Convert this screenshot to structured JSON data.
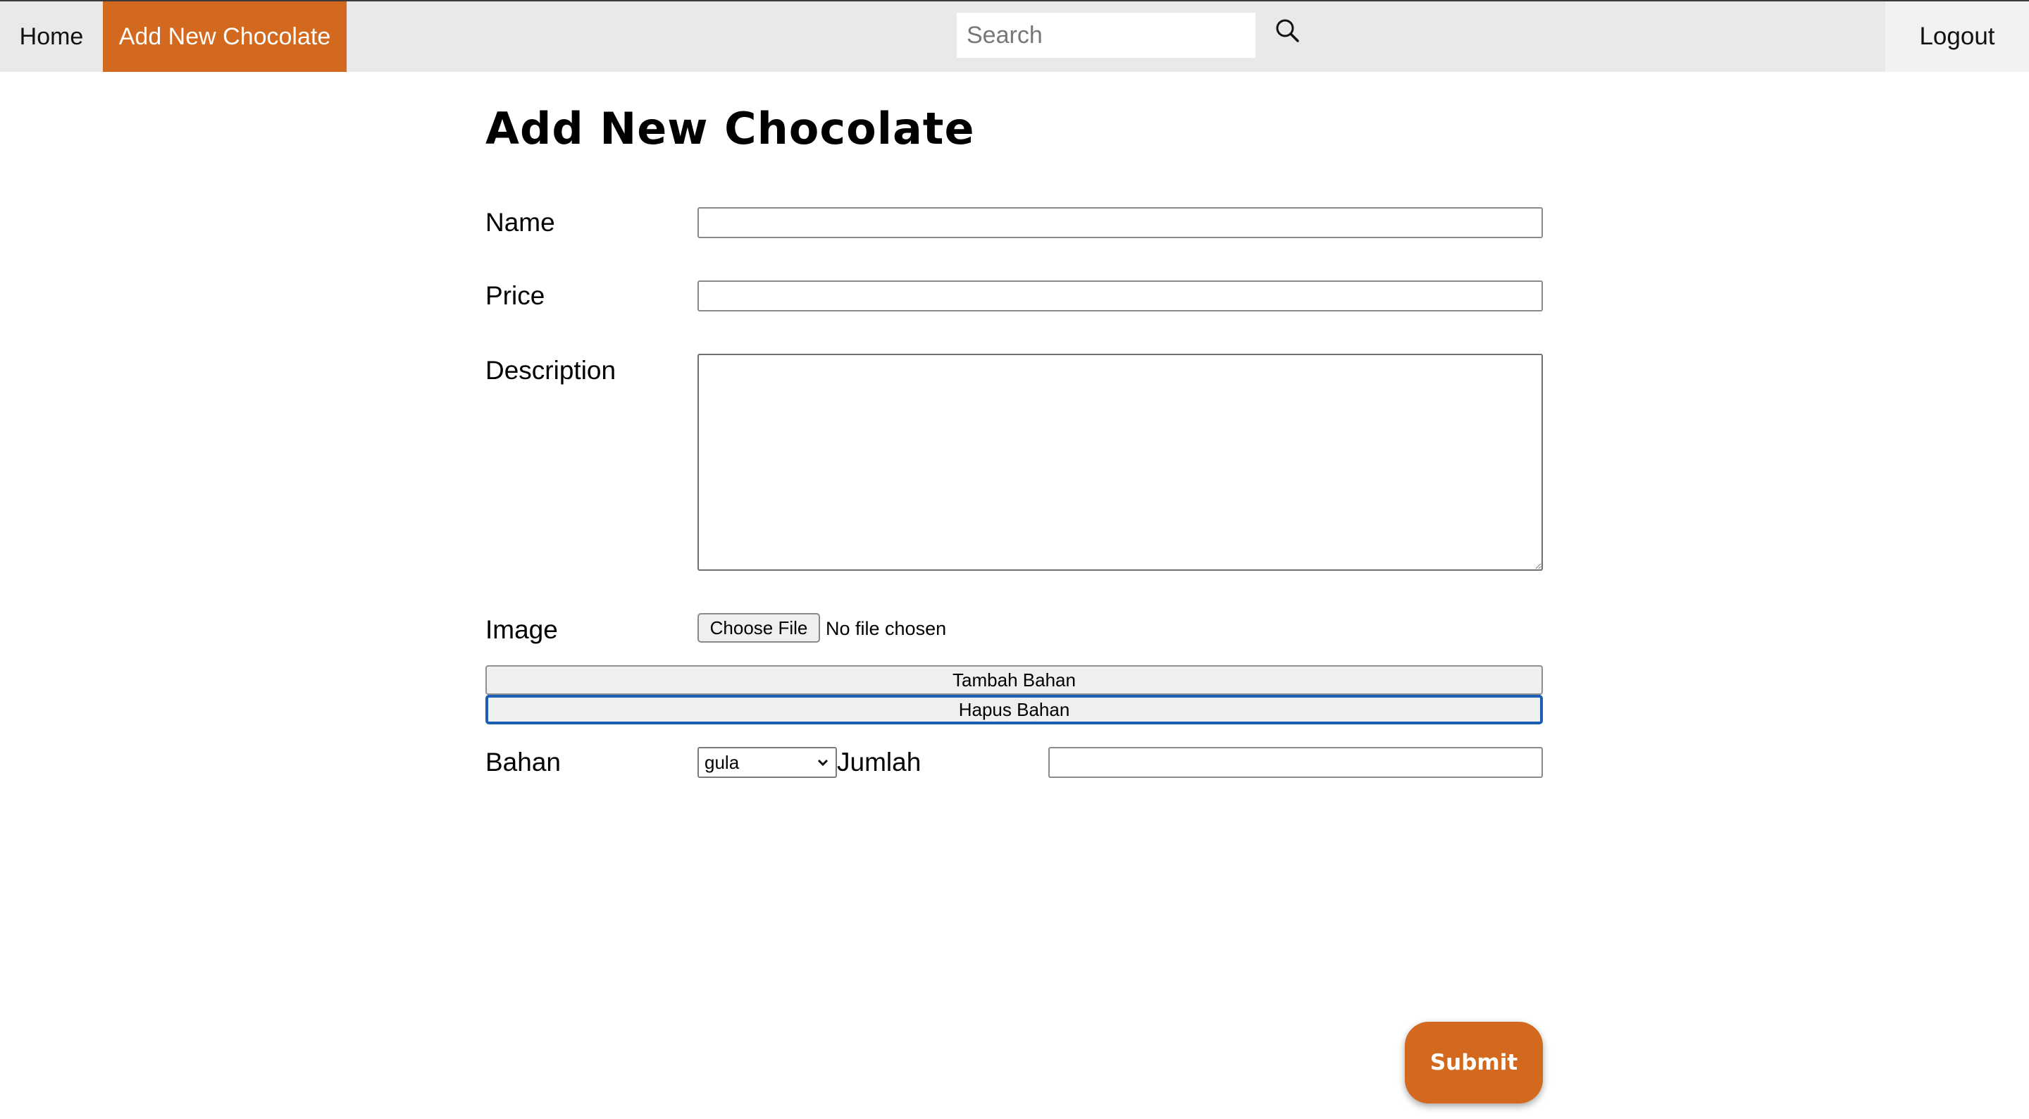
{
  "nav": {
    "home_label": "Home",
    "add_label": "Add New Chocolate",
    "logout_label": "Logout",
    "search_placeholder": "Search",
    "search_icon": "search-icon",
    "accent_color": "#d2691e"
  },
  "page": {
    "title": "Add New Chocolate"
  },
  "form": {
    "name_label": "Name",
    "price_label": "Price",
    "description_label": "Description",
    "image_label": "Image",
    "choose_file_label": "Choose File",
    "file_status": "No file chosen",
    "add_ingredient_label": "Tambah Bahan",
    "remove_ingredient_label": "Hapus Bahan",
    "ingredient_label": "Bahan",
    "ingredient_selected": "gula",
    "amount_label": "Jumlah",
    "submit_label": "Submit"
  }
}
